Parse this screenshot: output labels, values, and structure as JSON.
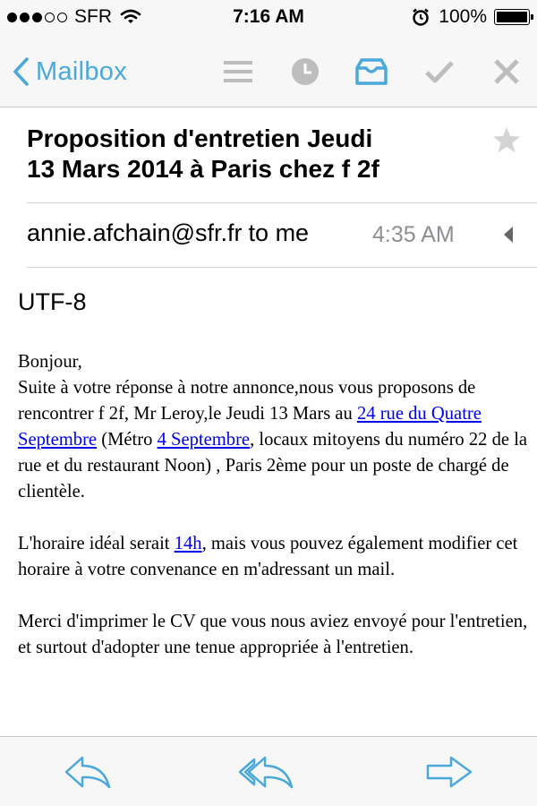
{
  "status_bar": {
    "carrier": "SFR",
    "signal_bars_filled": 3,
    "signal_bars_total": 5,
    "time": "7:16 AM",
    "battery_percent": "100%"
  },
  "nav": {
    "back_label": "Mailbox",
    "icons": [
      "list-icon",
      "clock-icon",
      "archive-box-icon",
      "check-icon",
      "close-icon"
    ],
    "accent_color": "#4aa8db",
    "inactive_color": "#bdbdbd"
  },
  "email": {
    "subject_line1": "Proposition d'entretien Jeudi",
    "subject_line2": "13 Mars 2014 à Paris chez f 2f",
    "sender": "annie.afchain@sfr.fr",
    "recipient_text": "to me",
    "time": "4:35 AM",
    "encoding": "UTF-8",
    "greeting": "Bonjour,",
    "p1_a": "Suite à votre réponse à notre annonce,nous vous proposons de rencontrer f 2f, Mr Leroy,le Jeudi 13 Mars au ",
    "p1_link1": "24 rue du Quatre Septembre",
    "p1_b": " (Métro ",
    "p1_link2": "4 Septembre",
    "p1_c": ", locaux mitoyens du numéro 22 de la rue et du restaurant Noon) , Paris 2ème pour un poste de chargé de clientèle.",
    "p2_a": "L'horaire idéal serait ",
    "p2_link": "14h",
    "p2_b": ", mais vous pouvez également modifier cet horaire à votre convenance en m'adressant un mail.",
    "p3": "Merci d'imprimer le CV que vous nous aviez envoyé pour l'entretien, et surtout d'adopter une tenue appropriée à l'entretien.",
    "link_color": "#0000ee"
  },
  "toolbar": {
    "icons": [
      "reply-icon",
      "reply-all-icon",
      "forward-icon"
    ],
    "color": "#4aa8db"
  }
}
